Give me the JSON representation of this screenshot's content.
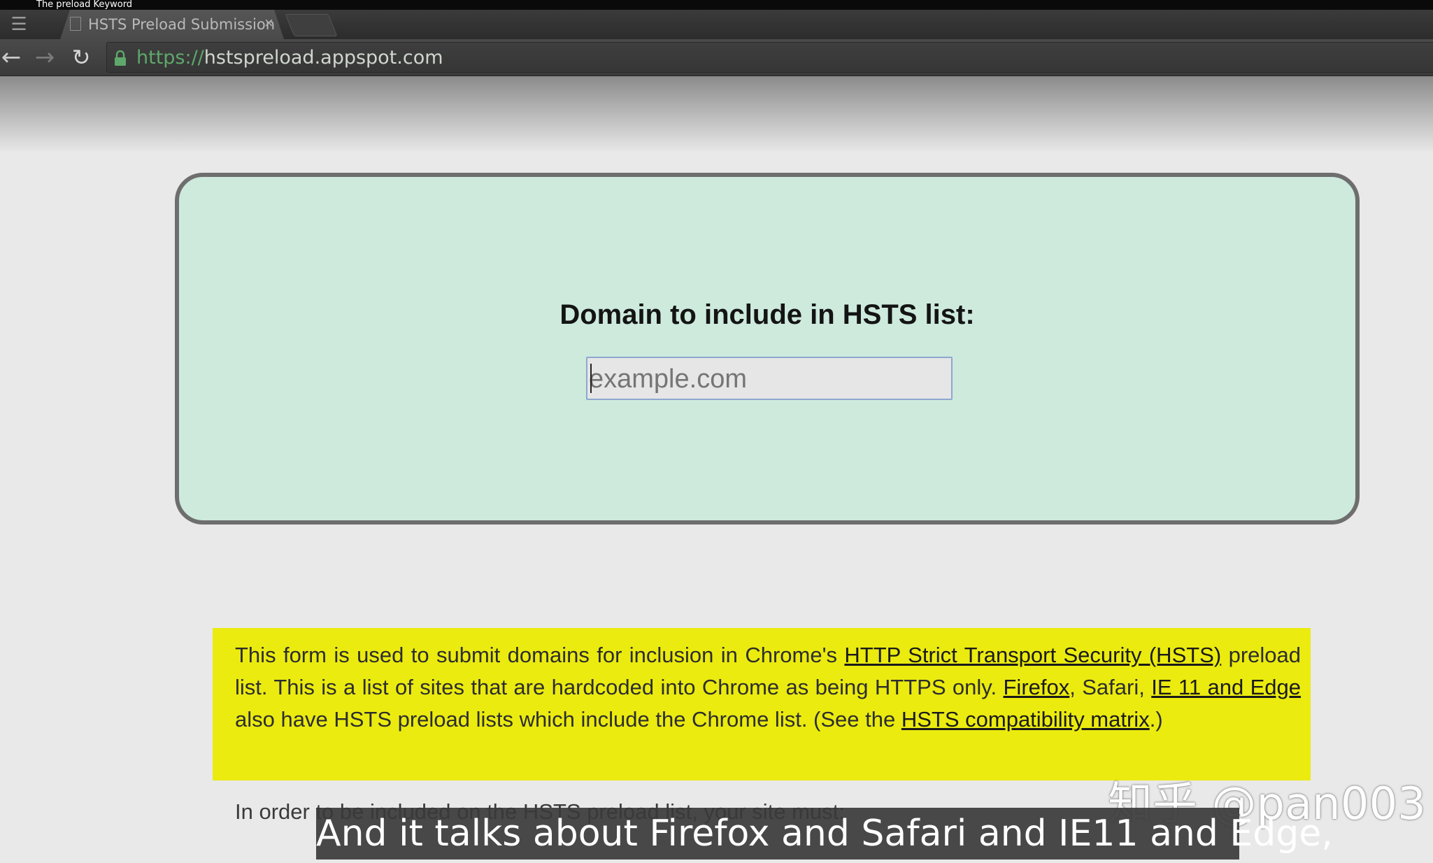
{
  "window": {
    "title": "The preload Keyword"
  },
  "browser": {
    "tab_title": "HSTS Preload Submission",
    "tab_close": "×",
    "url_scheme": "https://",
    "url_host": "hstspreload.appspot.com",
    "icons": {
      "back": "back-arrow-icon",
      "forward": "forward-arrow-icon",
      "reload": "reload-icon",
      "lock": "lock-icon",
      "menu": "app-menu-icon",
      "page": "page-icon"
    }
  },
  "form": {
    "heading": "Domain to include in HSTS list:",
    "input_placeholder": "example.com"
  },
  "info": {
    "p1": "This form is used to submit domains for inclusion in Chrome's ",
    "link_hsts": "HTTP Strict Transport Security (HSTS)",
    "p2": " preload list. This is a list of sites that are hardcoded into Chrome as being HTTPS only. ",
    "link_firefox": "Firefox",
    "p3": ", Safari, ",
    "link_ie_edge": "IE 11 and Edge",
    "p4": " also have HSTS preload lists which include the Chrome list. (See the ",
    "link_matrix": "HSTS compatibility matrix",
    "p5": ".)"
  },
  "requirements_intro": "In order to be included on the HSTS preload list, your site must:",
  "overlay": {
    "watermark": "知乎 @pan003",
    "subtitle": "And it talks about Firefox and Safari and IE11 and Edge,"
  },
  "colors": {
    "form_bg": "#cdeadd",
    "info_bg": "#ebeb10",
    "secure_green": "#5fa86b"
  }
}
